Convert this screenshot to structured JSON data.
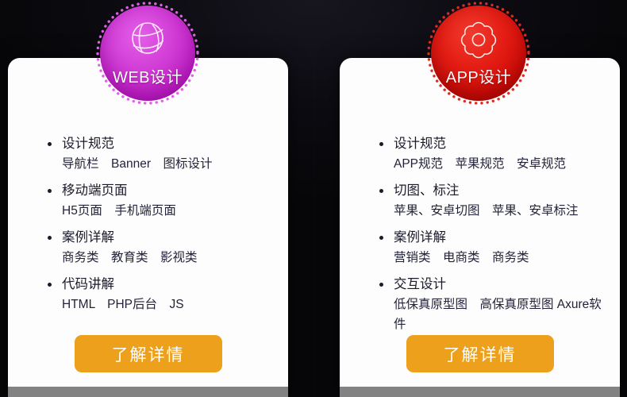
{
  "theme": {
    "page_background": "#070709",
    "card_background": "#fdfdfd",
    "text_color": "#1b1b2b",
    "cta_color": "#eda01c",
    "scrollbar_color": "#828282",
    "web_badge_color": "#c223c6",
    "app_badge_color": "#d10d08"
  },
  "cards": [
    {
      "badge": {
        "label": "WEB设计",
        "icon": "globe-icon",
        "color": "#c223c6"
      },
      "items": [
        {
          "title": "设计规范",
          "sub": "导航栏　Banner　图标设计"
        },
        {
          "title": "移动端页面",
          "sub": "H5页面　手机端页面"
        },
        {
          "title": "案例详解",
          "sub": "商务类　教育类　影视类"
        },
        {
          "title": "代码讲解",
          "sub": "HTML　PHP后台　JS"
        }
      ],
      "cta_label": "了解详情"
    },
    {
      "badge": {
        "label": "APP设计",
        "icon": "gear-icon",
        "color": "#d10d08"
      },
      "items": [
        {
          "title": "设计规范",
          "sub": "APP规范　苹果规范　安卓规范"
        },
        {
          "title": "切图、标注",
          "sub": "苹果、安卓切图　苹果、安卓标注"
        },
        {
          "title": "案例详解",
          "sub": "营销类　电商类　商务类"
        },
        {
          "title": "交互设计",
          "sub": "低保真原型图　高保真原型图 Axure软件"
        }
      ],
      "cta_label": "了解详情"
    }
  ]
}
